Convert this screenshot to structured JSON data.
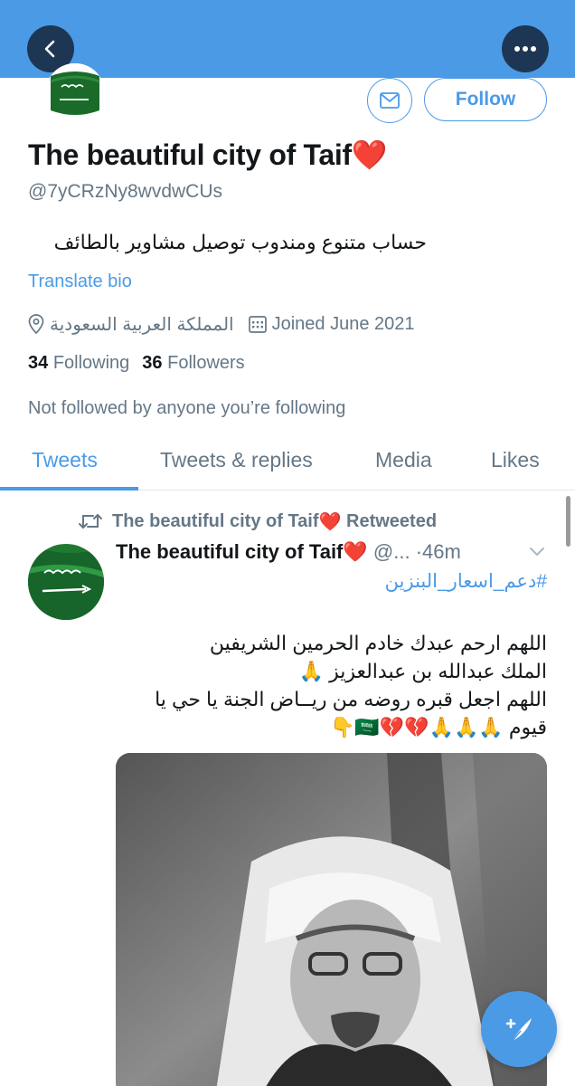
{
  "header": {
    "accent": "#4b9ae6",
    "back_icon": "chevron-left-icon",
    "more_icon": "more-horizontal-icon"
  },
  "profile": {
    "display_name": "The beautiful city of Taif",
    "name_emoji": "❤️",
    "handle": "@7yCRzNy8wvdwCUs",
    "bio": "حساب متنوع ومندوب توصيل مشاوير بالطائف",
    "translate_label": "Translate bio",
    "location": "المملكة العربية السعودية",
    "joined": "Joined June 2021",
    "following_count": "34",
    "following_label": "Following",
    "followers_count": "36",
    "followers_label": "Followers",
    "not_followed_text": "Not followed by anyone you’re following",
    "follow_button": "Follow"
  },
  "tabs": [
    {
      "label": "Tweets",
      "active": true
    },
    {
      "label": "Tweets & replies",
      "active": false
    },
    {
      "label": "Media",
      "active": false
    },
    {
      "label": "Likes",
      "active": false
    }
  ],
  "tweet": {
    "retweet_by": "The beautiful city of Taif",
    "retweet_heart": "❤️",
    "retweet_label": "Retweeted",
    "author_name": "The beautiful city of Taif",
    "author_heart": "❤️",
    "author_handle": "@...",
    "time": "·46m",
    "hashtag": "#دعم_اسعار_البنزين",
    "lines": [
      "اللهم ارحم عبدك خادم الحرمين الشريفين",
      "الملك عبدالله بن عبدالعزيز 🙏",
      "اللهم اجعل قبره روضه من ريــاض الجنة يا حي يا",
      "قيوم 🙏🙏🙏💔💔🇸🇦👇"
    ]
  }
}
